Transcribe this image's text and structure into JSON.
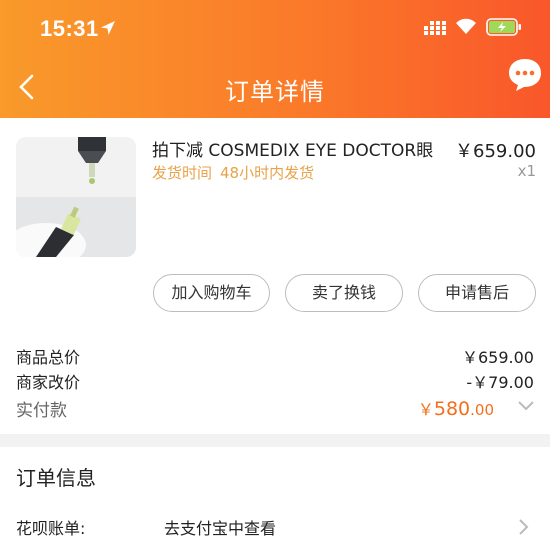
{
  "status_bar": {
    "time": "15:31"
  },
  "header": {
    "title": "订单详情"
  },
  "product": {
    "title": "拍下减 COSMEDIX EYE DOCTOR眼",
    "ship_label": "发货时间",
    "ship_value": "48小时内发货",
    "price": "￥659.00",
    "quantity": "x1"
  },
  "actions": {
    "add_to_cart": "加入购物车",
    "resell": "卖了换钱",
    "after_sales": "申请售后"
  },
  "summary": {
    "total_label": "商品总价",
    "total_value": "￥659.00",
    "adjust_label": "商家改价",
    "adjust_value": "-￥79.00",
    "paid_label": "实付款",
    "paid_currency": "￥",
    "paid_integer": "580",
    "paid_decimal": ".00"
  },
  "order_info": {
    "title": "订单信息",
    "huabei_label": "花呗账单:",
    "huabei_link": "去支付宝中查看"
  },
  "colors": {
    "accent": "#f36f1e",
    "header_gradient_start": "#f99a2a",
    "header_gradient_end": "#f9572a",
    "ship_info": "#e8a34a"
  }
}
